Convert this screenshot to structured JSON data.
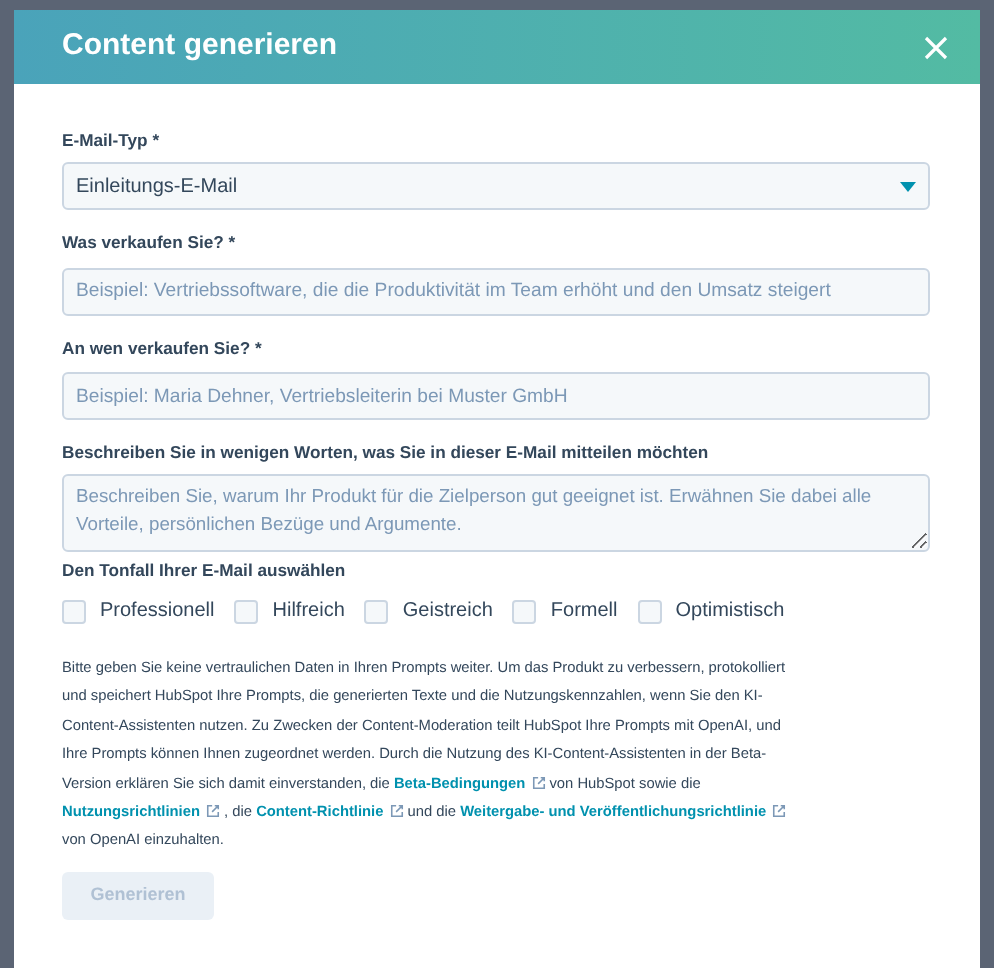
{
  "dialog": {
    "title": "Content generieren"
  },
  "fields": [
    {
      "kind": "select",
      "label": "E-Mail-Typ *",
      "value": "Einleitungs-E-Mail"
    },
    {
      "kind": "input",
      "label": "Was verkaufen Sie? *",
      "placeholder": "Beispiel: Vertriebssoftware, die die Produktivität im Team erhöht und den Umsatz steigert"
    },
    {
      "kind": "input",
      "label": "An wen verkaufen Sie? *",
      "placeholder": "Beispiel: Maria Dehner, Vertriebsleiterin bei Muster GmbH"
    },
    {
      "kind": "textarea",
      "label": "Beschreiben Sie in wenigen Worten, was Sie in dieser E-Mail mitteilen möchten",
      "placeholder": "Beschreiben Sie, warum Ihr Produkt für die Zielperson gut geeignet ist. Erwähnen Sie dabei alle Vorteile, persönlichen Bezüge und Argumente."
    }
  ],
  "tone": {
    "label": "Den Tonfall Ihrer E-Mail auswählen",
    "options": [
      {
        "label": "Professionell",
        "checked": false
      },
      {
        "label": "Hilfreich",
        "checked": false
      },
      {
        "label": "Geistreich",
        "checked": false
      },
      {
        "label": "Formell",
        "checked": false
      },
      {
        "label": "Optimistisch",
        "checked": false
      }
    ]
  },
  "disclaimer": [
    {
      "kind": "text",
      "text": "Bitte geben Sie keine vertraulichen Daten in Ihren Prompts weiter. Um das Produkt zu verbessern, protokolliert und speichert HubSpot Ihre Prompts, die generierten Texte und die Nutzungskennzahlen, wenn Sie den KI-Content-Assistenten nutzen. Zu Zwecken der Content-Moderation teilt HubSpot Ihre Prompts mit OpenAI, und Ihre Prompts können Ihnen zugeordnet werden. Durch die Nutzung des KI-Content-Assistenten in der Beta-Version erklären Sie sich damit einverstanden, die "
    },
    {
      "kind": "link",
      "text": "Beta-Bedingungen",
      "external": true
    },
    {
      "kind": "text",
      "text": " von HubSpot sowie die "
    },
    {
      "kind": "link",
      "text": "Nutzungsrichtlinien",
      "external": true
    },
    {
      "kind": "text",
      "text": " , die "
    },
    {
      "kind": "link",
      "text": "Content-Richtlinie",
      "external": true
    },
    {
      "kind": "text",
      "text": " und die "
    },
    {
      "kind": "link",
      "text": "Weitergabe- und",
      "external": false
    },
    {
      "kind": "link",
      "text": "Veröffentlichungsrichtlinie",
      "external": true
    },
    {
      "kind": "text",
      "text": " von OpenAI einzuhalten."
    }
  ],
  "submit": {
    "label": "Generieren",
    "disabled": true
  }
}
